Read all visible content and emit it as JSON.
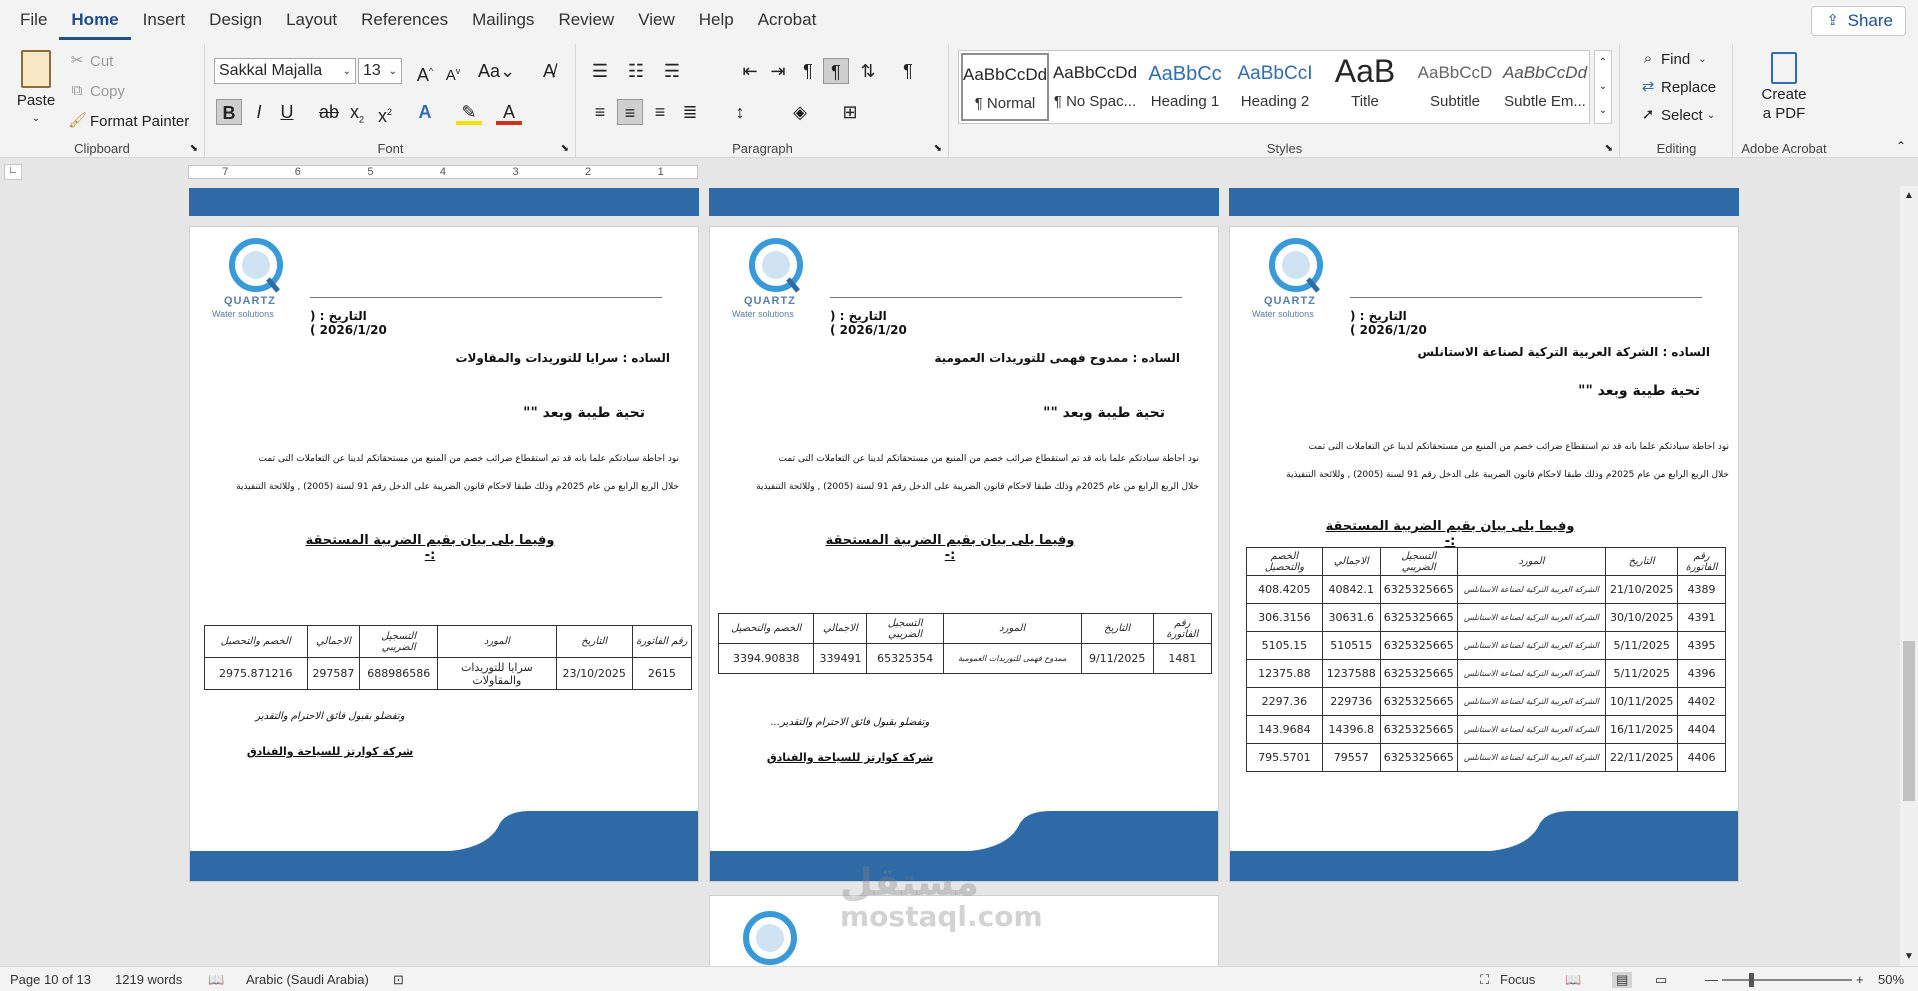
{
  "tabs": [
    "File",
    "Home",
    "Insert",
    "Design",
    "Layout",
    "References",
    "Mailings",
    "Review",
    "View",
    "Help",
    "Acrobat"
  ],
  "share_label": "Share",
  "clipboard": {
    "paste": "Paste",
    "cut": "Cut",
    "copy": "Copy",
    "format_painter": "Format Painter",
    "label": "Clipboard"
  },
  "font": {
    "name": "Sakkal Majalla",
    "size": "13",
    "label": "Font"
  },
  "paragraph": {
    "label": "Paragraph"
  },
  "styles": {
    "label": "Styles",
    "items": [
      {
        "preview": "AaBbCcDd",
        "name": "¶ Normal"
      },
      {
        "preview": "AaBbCcDd",
        "name": "¶ No Spac..."
      },
      {
        "preview": "AaBbCc",
        "name": "Heading 1"
      },
      {
        "preview": "AaBbCcI",
        "name": "Heading 2"
      },
      {
        "preview": "AaB",
        "name": "Title"
      },
      {
        "preview": "AaBbCcD",
        "name": "Subtitle"
      },
      {
        "preview": "AaBbCcDd",
        "name": "Subtle Em..."
      }
    ]
  },
  "editing": {
    "find": "Find",
    "replace": "Replace",
    "select": "Select",
    "label": "Editing"
  },
  "acrobat": {
    "create": "Create",
    "pdf": "a PDF",
    "label": "Adobe Acrobat"
  },
  "ruler_numbers": [
    "7",
    "6",
    "5",
    "4",
    "3",
    "2",
    "1"
  ],
  "letters": [
    {
      "date": "التاريخ : ( 2026/1/20 )",
      "to_label": "الساده :",
      "to": "سرايا للتوريدات والمقاولات",
      "greeting": "تحية طيبة وبعد \"\"",
      "body1": "نود احاطة سيادتكم علما بانه قد تم استقطاع ضرائب خصم من المنبع من مستحقاتكم لدينا عن التعاملات التى تمت",
      "body2": "خلال الربع الرابع من عام 2025م وذلك طبقا لاحكام قانون الضريبة على الدخل رقم 91 لسنة (2005) , وللائحة التنفيذية",
      "heading": "وفيما يلى بيان بقيم الضريبة المستحقة :-",
      "closing": "وتفضلو بقبول فائق الاحترام والتقدير",
      "company": "شركة كوارتز للسياحة والفنادق",
      "headers": [
        "رقم الفاتورة",
        "التاريخ",
        "المورد",
        "التسجيل الضريبي",
        "الاجمالي",
        "الخصم والتحصيل"
      ],
      "rows": [
        [
          "2615",
          "23/10/2025",
          "سرايا للتوريدات والمقاولات",
          "688986586",
          "297587",
          "2975.871216"
        ]
      ]
    },
    {
      "date": "التاريخ : ( 2026/1/20 )",
      "to_label": "الساده :",
      "to": "ممدوح فهمى للتوريدات العمومية",
      "greeting": "تحية طيبة وبعد \"\"",
      "body1": "نود احاطة سيادتكم علما بانه قد تم استقطاع ضرائب خصم من المنبع من مستحقاتكم لدينا عن التعاملات التى تمت",
      "body2": "خلال الربع الرابع من عام 2025م وذلك طبقا لاحكام قانون الضريبة على الدخل رقم 91 لسنة (2005) , وللائحة التنفيذية",
      "heading": "وفيما يلى بيان بقيم الضريبة المستحقة :-",
      "closing": "وتفضلو بقبول فائق الاحترام والتقدير...",
      "company": "شركة كوارتز للسياحة والفنادق",
      "headers": [
        "رقم الفاتورة",
        "التاريخ",
        "المورد",
        "التسجيل الضريبي",
        "الاجمالي",
        "الخصم والتحصيل"
      ],
      "rows": [
        [
          "1481",
          "9/11/2025",
          "ممدوح فهمى للتوريدات العمومية",
          "65325354",
          "339491",
          "3394.90838"
        ]
      ]
    },
    {
      "date": "التاريخ : ( 2026/1/20 )",
      "to_label": "الساده :",
      "to": "الشركة العربية التركية لصناعة الاستانلس",
      "greeting": "تحية طيبة وبعد \"\"",
      "body1": "نود احاطة سيادتكم علما بانه قد تم استقطاع ضرائب خصم من المنبع من مستحقاتكم لدينا عن التعاملات التى تمت",
      "body2": "خلال الربع الرابع من عام 2025م وذلك طبقا لاحكام قانون الضريبة على الدخل رقم 91 لسنة (2005) , وللائحة التنفيذية",
      "heading": "وفيما يلى بيان بقيم الضريبة المستحقة :-",
      "headers": [
        "رقم الفاتورة",
        "التاريخ",
        "المورد",
        "التسجيل الضريبي",
        "الاجمالي",
        "الخصم والتحصيل"
      ],
      "rows": [
        [
          "4389",
          "21/10/2025",
          "الشركة العربية التركية لصناعة الاستانلس",
          "6325325665",
          "40842.1",
          "408.4205"
        ],
        [
          "4391",
          "30/10/2025",
          "الشركة العربية التركية لصناعة الاستانلس",
          "6325325665",
          "30631.6",
          "306.3156"
        ],
        [
          "4395",
          "5/11/2025",
          "الشركة العربية التركية لصناعة الاستانلس",
          "6325325665",
          "510515",
          "5105.15"
        ],
        [
          "4396",
          "5/11/2025",
          "الشركة العربية التركية لصناعة الاستانلس",
          "6325325665",
          "1237588",
          "12375.88"
        ],
        [
          "4402",
          "10/11/2025",
          "الشركة العربية التركية لصناعة الاستانلس",
          "6325325665",
          "229736",
          "2297.36"
        ],
        [
          "4404",
          "16/11/2025",
          "الشركة العربية التركية لصناعة الاستانلس",
          "6325325665",
          "14396.8",
          "143.9684"
        ],
        [
          "4406",
          "22/11/2025",
          "الشركة العربية التركية لصناعة الاستانلس",
          "6325325665",
          "79557",
          "795.5701"
        ]
      ]
    }
  ],
  "logo": {
    "brand": "QUARTZ",
    "tagline": "Water solutions"
  },
  "status": {
    "page": "Page 10 of 13",
    "words": "1219 words",
    "language": "Arabic (Saudi Arabia)",
    "focus": "Focus",
    "zoom": "50%"
  },
  "watermark": {
    "arabic": "مستقل",
    "latin": "mostaql.com"
  },
  "colors": {
    "accent": "#1e4e8c",
    "band": "#2e6aa5"
  }
}
